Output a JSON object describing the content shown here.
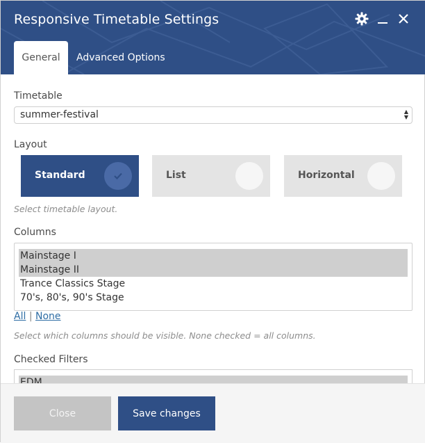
{
  "dialog": {
    "title": "Responsive Timetable Settings",
    "icons": {
      "settings": "gear-icon",
      "minimize": "minimize-icon",
      "close": "close-icon"
    }
  },
  "tabs": [
    {
      "label": "General",
      "active": true
    },
    {
      "label": "Advanced Options",
      "active": false
    }
  ],
  "timetable": {
    "label": "Timetable",
    "selected": "summer-festival"
  },
  "layout": {
    "label": "Layout",
    "options": [
      {
        "label": "Standard",
        "selected": true
      },
      {
        "label": "List",
        "selected": false
      },
      {
        "label": "Horizontal",
        "selected": false
      }
    ],
    "help": "Select timetable layout."
  },
  "columns": {
    "label": "Columns",
    "items": [
      {
        "label": "Mainstage I",
        "selected": true
      },
      {
        "label": "Mainstage II",
        "selected": true
      },
      {
        "label": "Trance Classics Stage",
        "selected": false
      },
      {
        "label": "70's, 80's, 90's Stage",
        "selected": false
      }
    ],
    "links": {
      "all": "All",
      "separator": "|",
      "none": "None"
    },
    "help": "Select which columns should be visible. None checked = all columns."
  },
  "checked_filters": {
    "label": "Checked Filters",
    "items": [
      {
        "label": "EDM",
        "selected": true
      }
    ]
  },
  "footer": {
    "close_label": "Close",
    "save_label": "Save changes"
  },
  "colors": {
    "accent": "#2f4f86",
    "tile": "#e4e4e4",
    "selection": "#cfcfcf",
    "link": "#2e6da4"
  }
}
